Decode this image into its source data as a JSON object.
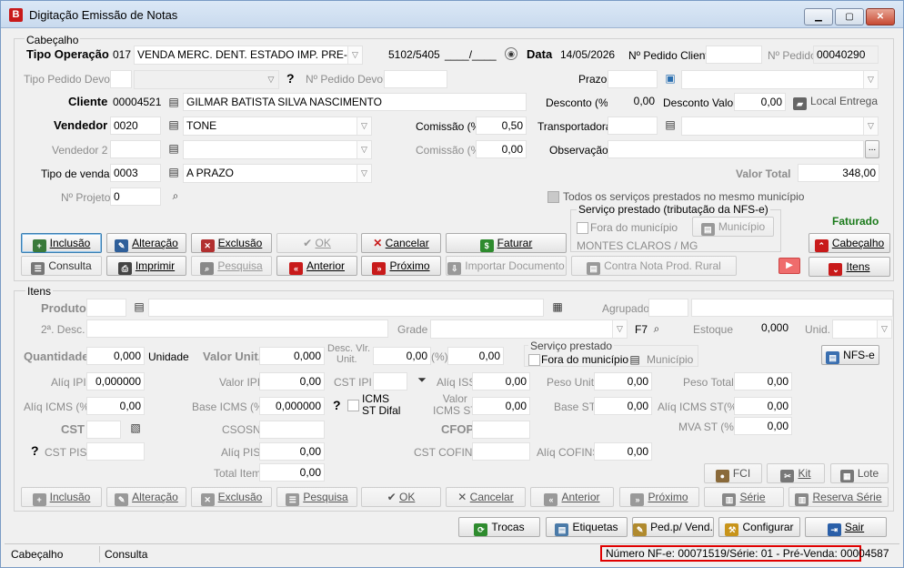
{
  "window": {
    "icon_letter": "B",
    "title": "Digitação Emissão de Notas"
  },
  "cabecalho": {
    "group_label": "Cabeçalho",
    "tipo_operacao": {
      "label": "Tipo Operação",
      "code": "017",
      "desc": "VENDA MERC. DENT. ESTADO IMP. PRE-VEN",
      "cfop": "5102/5405",
      "date_mask": "____/____"
    },
    "data": {
      "label": "Data",
      "value": "14/05/2026"
    },
    "pedido_cliente": {
      "label": "Nº Pedido Cliente",
      "value": ""
    },
    "pedido": {
      "label": "Nº Pedido",
      "value": "00040290"
    },
    "tipo_pedido_devol": {
      "label": "Tipo Pedido Devol.",
      "value": ""
    },
    "pedido_devol": {
      "label": "Nº Pedido Devol.",
      "value": ""
    },
    "prazo": {
      "label": "Prazo",
      "value": ""
    },
    "cliente": {
      "label": "Cliente",
      "code": "00004521",
      "name": "GILMAR BATISTA SILVA NASCIMENTO"
    },
    "desconto": {
      "label": "Desconto (%)",
      "value": "0,00"
    },
    "desconto_valor": {
      "label": "Desconto Valor",
      "value": "0,00"
    },
    "local_entrega_label": "Local Entrega",
    "vendedor": {
      "label": "Vendedor",
      "code": "0020",
      "name": "TONE"
    },
    "comissao": {
      "label": "Comissão (%)",
      "value": "0,50"
    },
    "transportadora": {
      "label": "Transportadora",
      "value": ""
    },
    "vendedor2": {
      "label": "Vendedor 2",
      "code": "",
      "name": ""
    },
    "comissao2": {
      "label": "Comissão (%)",
      "value": "0,00"
    },
    "observacao": {
      "label": "Observação",
      "value": ""
    },
    "tipo_venda": {
      "label": "Tipo de venda",
      "code": "0003",
      "desc": "A PRAZO"
    },
    "valor_total": {
      "label": "Valor Total",
      "value": "348,00"
    },
    "projeto": {
      "label": "Nº Projeto",
      "value": "0"
    },
    "todos_servicos": "Todos os serviços prestados no mesmo município",
    "servico_group": "Serviço prestado (tributação da NFS-e)",
    "fora_municipio": "Fora do município",
    "municipio_btn": "Município",
    "municipio_value": "MONTES CLAROS / MG",
    "status": "Faturado"
  },
  "header_buttons": {
    "inclusao": "Inclusão",
    "alteracao": "Alteração",
    "exclusao": "Exclusão",
    "ok": "OK",
    "cancelar": "Cancelar",
    "faturar": "Faturar",
    "cabecalho": "Cabeçalho",
    "consulta": "Consulta",
    "imprimir": "Imprimir",
    "pesquisa": "Pesquisa",
    "anterior": "Anterior",
    "proximo": "Próximo",
    "importar": "Importar Documento",
    "contra_nota": "Contra Nota Prod. Rural",
    "itens": "Itens"
  },
  "itens": {
    "group_label": "Itens",
    "produto": "Produto",
    "agrupado": "Agrupado",
    "desc2": "2ª. Desc.",
    "grade": "Grade",
    "f7": "F7",
    "estoque": {
      "label": "Estoque",
      "value": "0,000"
    },
    "unid": "Unid.",
    "quantidade": {
      "label": "Quantidade",
      "value": "0,000"
    },
    "unidade": "Unidade",
    "valor_unit": {
      "label": "Valor Unit.",
      "value": "0,000"
    },
    "desc_vlr_unit": {
      "label1": "Desc. Vlr.",
      "label2": "Unit.",
      "value": "0,00",
      "pct": "(%)",
      "value2": "0,00"
    },
    "servico_prestado": "Serviço prestado",
    "fora_municipio": "Fora do município",
    "municipio": "Município",
    "nfse": "NFS-e",
    "aliq_ipi": {
      "label": "Alíq IPI",
      "value": "0,000000"
    },
    "valor_ipi": {
      "label": "Valor IPI",
      "value": "0,00"
    },
    "cst_ipi": "CST IPI",
    "aliq_iss": {
      "label": "Alíq ISS",
      "value": "0,00"
    },
    "peso_unit": {
      "label": "Peso Unit.",
      "value": "0,00"
    },
    "peso_total": {
      "label": "Peso Total",
      "value": "0,00"
    },
    "aliq_icms": {
      "label": "Alíq ICMS (%)",
      "value": "0,00"
    },
    "base_icms": {
      "label": "Base ICMS (%)",
      "value": "0,000000"
    },
    "icms_st_difal": {
      "l1": "ICMS",
      "l2": "ST Difal"
    },
    "valor_icms_st": {
      "l1": "Valor",
      "l2": "ICMS ST",
      "value": "0,00"
    },
    "base_st": {
      "label": "Base ST",
      "value": "0,00"
    },
    "aliq_icms_st": {
      "label": "Alíq ICMS ST(%)",
      "value": "0,00"
    },
    "cst": "CST",
    "csosn": "CSOSN",
    "cfop": "CFOP",
    "mva_st": {
      "label": "MVA ST (%)",
      "value": "0,00"
    },
    "cst_pis": "CST PIS",
    "aliq_pis": {
      "label": "Alíq PIS",
      "value": "0,00"
    },
    "cst_cofins": "CST COFINS",
    "aliq_cofins": {
      "label": "Alíq COFINS",
      "value": "0,00"
    },
    "total_item": {
      "label": "Total Item",
      "value": "0,00"
    },
    "fci": "FCI",
    "kit": "Kit",
    "lote": "Lote",
    "buttons": {
      "inclusao": "Inclusão",
      "alteracao": "Alteração",
      "exclusao": "Exclusão",
      "pesquisa": "Pesquisa",
      "ok": "OK",
      "cancelar": "Cancelar",
      "anterior": "Anterior",
      "proximo": "Próximo",
      "serie": "Série",
      "reserva_serie": "Reserva Série"
    }
  },
  "bottom_buttons": {
    "trocas": "Trocas",
    "etiquetas": "Etiquetas",
    "ped_vend": "Ped.p/ Vend.",
    "configurar": "Configurar",
    "sair": "Sair"
  },
  "statusbar": {
    "section": "Cabeçalho",
    "mode": "Consulta",
    "nfe_info": "Número NF-e: 00071519/Série: 01 - Pré-Venda: 00004587"
  },
  "colors": {
    "accent_red": "#c81a1a",
    "faturado_green": "#1a7a1a",
    "highlight_border": "#e00000"
  }
}
